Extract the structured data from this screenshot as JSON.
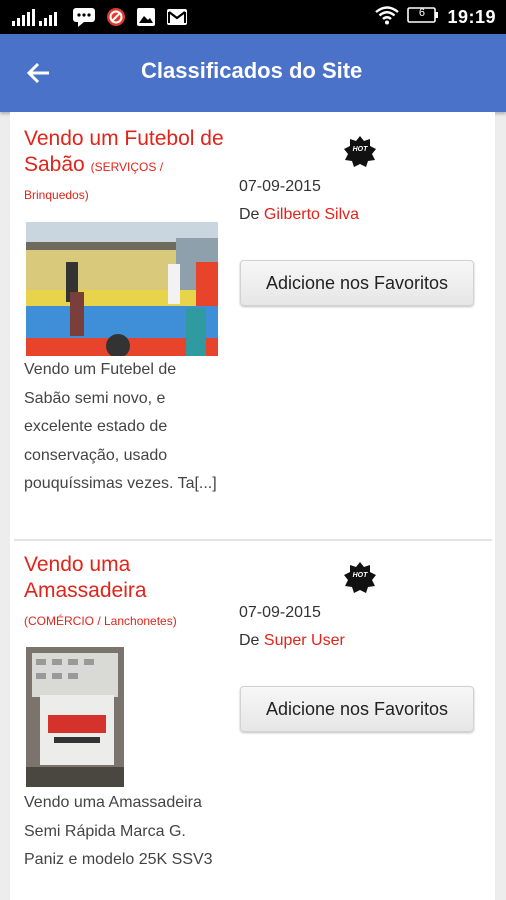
{
  "status_bar": {
    "time": "19:19",
    "battery": "6",
    "icons": [
      "signal-icon",
      "chat-icon",
      "no-sign-icon",
      "image-icon",
      "gmail-icon",
      "wifi-icon",
      "battery-icon"
    ]
  },
  "app_bar": {
    "title": "Classificados do Site",
    "back_icon": "arrow-left-icon",
    "color": "#4a72c9"
  },
  "ads": [
    {
      "title": "Vendo um Futebol de Sabão",
      "category": "(SERVIÇOS / Brinquedos)",
      "description": "Vendo um Futebel de Sabão semi novo, e excelente estado de conservação, usado pouquíssimas vezes. Ta[...]",
      "badge": "HOT",
      "date": "07-09-2015",
      "author_prefix": "De",
      "author": "Gilberto Silva",
      "favorite_label": "Adicione nos Favoritos"
    },
    {
      "title": "Vendo uma Amassadeira",
      "category": "(COMÉRCIO / Lanchonetes)",
      "description": "Vendo uma Amassadeira Semi Rápida Marca G. Paniz e modelo 25K SSV3",
      "badge": "HOT",
      "date": "07-09-2015",
      "author_prefix": "De",
      "author": "Super User",
      "favorite_label": "Adicione nos Favoritos"
    }
  ],
  "colors": {
    "accent_red": "#e2231a",
    "background": "#ededed"
  }
}
